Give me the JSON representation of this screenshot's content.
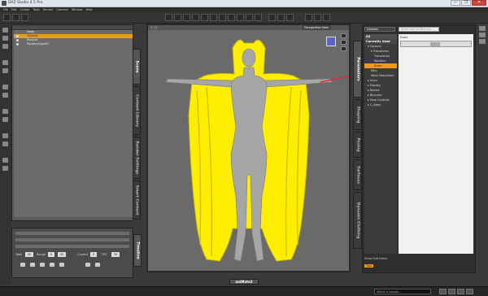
{
  "window": {
    "title": "DAZ Studio 4.5 Pro",
    "controls": [
      "—",
      "❐",
      "✕"
    ]
  },
  "menu": [
    "File",
    "Edit",
    "Create",
    "Tools",
    "Render",
    "Connect",
    "Window",
    "Help"
  ],
  "scene": {
    "header": "Node",
    "items": [
      {
        "label": "Genesis",
        "selected": true
      },
      {
        "label": "Bodikat",
        "selected": false
      },
      {
        "label": "MysteryCape01",
        "selected": false
      }
    ]
  },
  "left_tabs": [
    "Scene",
    "Content Library",
    "Render Settings",
    "Smart Content"
  ],
  "timeline": {
    "tab_label": "Timeline",
    "fields": [
      {
        "label": "Total",
        "value": "30"
      },
      {
        "label": "Range",
        "value": "0"
      },
      {
        "label": "",
        "value": "30"
      },
      {
        "label": "Current",
        "value": "0"
      },
      {
        "label": "FPS",
        "value": "30"
      }
    ]
  },
  "viewport": {
    "coords": "Y: 12",
    "view_label": "Perspective View",
    "colors": {
      "cape": "#ffee00",
      "figure": "#a6a6a6",
      "bg": "#6a6a6a"
    }
  },
  "param_tabs": [
    "Parameters",
    "Shaping",
    "Posing",
    "Surfaces",
    "Dynamic Clothing"
  ],
  "parameters": {
    "dropdown": "Genesis",
    "search_placeholder": "Enter text to filter by...",
    "tree": [
      {
        "label": "All",
        "cls": "hdr"
      },
      {
        "label": "Currently Used",
        "cls": "hdr hdr2"
      },
      {
        "label": "▾ General",
        "cls": "l1"
      },
      {
        "label": "▾ Transforms",
        "cls": "l2"
      },
      {
        "label": "Translation",
        "cls": "l3"
      },
      {
        "label": "Rotation",
        "cls": "l3"
      },
      {
        "label": "Scale",
        "cls": "l3 sel"
      },
      {
        "label": "Misc",
        "cls": "l2"
      },
      {
        "label": "Mesh Resolution",
        "cls": "l2"
      },
      {
        "label": "▸ Actor",
        "cls": "l1"
      },
      {
        "label": "▸ Display",
        "cls": "l1"
      },
      {
        "label": "▸ Bodies",
        "cls": "l1"
      },
      {
        "label": "▸ Bicycles",
        "cls": "l1"
      },
      {
        "label": "▸ Pose Controls",
        "cls": "l1"
      },
      {
        "label": "▸ C_Away",
        "cls": "l1"
      }
    ],
    "value_label": "Scale",
    "show_sub_items": "Show Sub Items",
    "tips": "Tips"
  },
  "bottom": {
    "animate_tab": "aniMate2",
    "lesson_select": "Select a Lesson..."
  }
}
